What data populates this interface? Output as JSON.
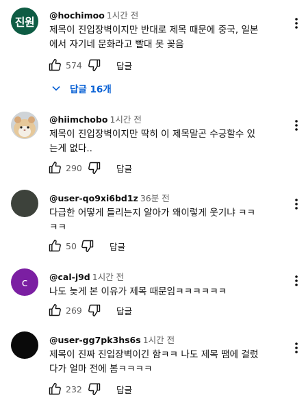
{
  "comments": [
    {
      "avatar": {
        "text": "진원",
        "color": "#0e5c44"
      },
      "author": "@hochimoo",
      "time": "1시간 전",
      "lines": [
        "제목이 진입장벽이지만 반대로 제목 때문에 중국, 일본",
        "에서 자기네 문화라고 빨대 못 꽂음"
      ],
      "likes": "574",
      "reply_label": "답글",
      "replies_label": "답글 16개"
    },
    {
      "avatar": {
        "text": "",
        "color": "#d9cfbf"
      },
      "author": "@hiimchobo",
      "time": "1시간 전",
      "lines": [
        "제목이 진입장벽이지만 딱히 이 제목말곤 수긍할수 있",
        "는게 없다.."
      ],
      "likes": "290",
      "reply_label": "답글"
    },
    {
      "avatar": {
        "text": "",
        "color": "#3d423b"
      },
      "author": "@user-qo9xi6bd1z",
      "time": "36분 전",
      "lines": [
        "다급한 어떻게 들리는지 알아가 왜이렇게 웃기냐 ㅋㅋ",
        "ㅋㅋ"
      ],
      "likes": "50",
      "reply_label": "답글"
    },
    {
      "avatar": {
        "text": "c",
        "color": "#7b1fa2"
      },
      "author": "@cal-j9d",
      "time": "1시간 전",
      "lines": [
        "나도 늦게 본 이유가 제목 때문임ㅋㅋㅋㅋㅋㅋ"
      ],
      "likes": "269",
      "reply_label": "답글"
    },
    {
      "avatar": {
        "text": "",
        "color": "#0a0a0a"
      },
      "author": "@user-gg7pk3hs6s",
      "time": "1시간 전",
      "lines": [
        "제목이 진짜 진입장벽이긴 함ㅋㅋ 나도 제목 땜에 걸렀",
        "다가 얼마 전에 봄ㅋㅋㅋㅋ"
      ],
      "likes": "232",
      "reply_label": "답글"
    }
  ]
}
